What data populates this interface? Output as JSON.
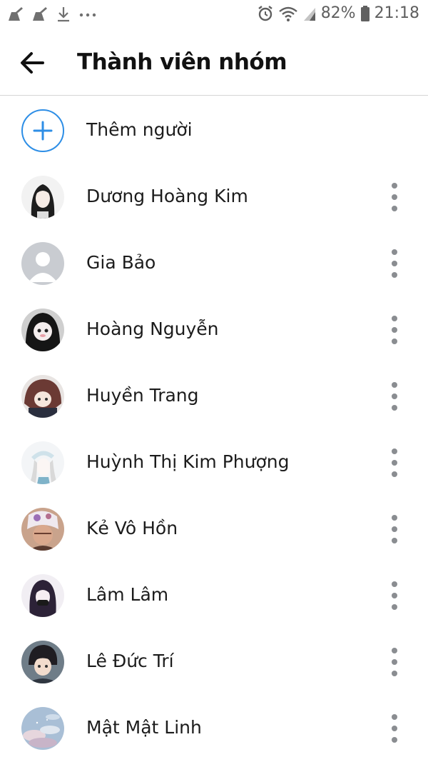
{
  "status_bar": {
    "battery": "82%",
    "time": "21:18",
    "icons": [
      "sweep-icon",
      "sweep-icon",
      "download-icon",
      "more-notifications-icon",
      "alarm-icon",
      "wifi-icon",
      "signal-icon",
      "battery-icon"
    ]
  },
  "header": {
    "title": "Thành viên nhóm",
    "back_icon": "arrow-left-icon"
  },
  "add_person": {
    "label": "Thêm người",
    "icon": "plus-icon",
    "accent": "#2d8ee6"
  },
  "members": [
    {
      "name": "Dương Hoàng Kim"
    },
    {
      "name": "Gia Bảo"
    },
    {
      "name": "Hoàng Nguyễn"
    },
    {
      "name": "Huyền Trang"
    },
    {
      "name": "Huỳnh Thị Kim Phượng"
    },
    {
      "name": "Kẻ Vô Hồn"
    },
    {
      "name": "Lâm Lâm"
    },
    {
      "name": "Lê Đức Trí"
    },
    {
      "name": "Mật Mật Linh"
    }
  ]
}
